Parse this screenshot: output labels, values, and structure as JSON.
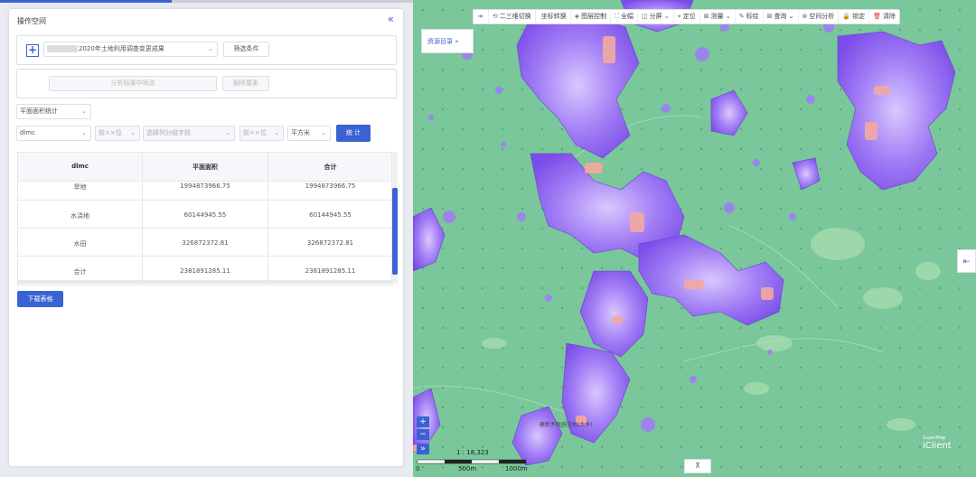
{
  "panel": {
    "title": "操作空间",
    "collapse_icon": "«",
    "layer_select": "2020年土地利用调查变更成果",
    "filter_button": "筛选条件",
    "analysis_filter_button": "分析结果中筛选",
    "delete_button": "删除要素",
    "stat_type": "平面面积统计",
    "field_select": "dlmc",
    "digits_select_1": "前××位",
    "group_field_placeholder": "选择列分组字段",
    "digits_select_2": "前××位",
    "unit_select": "平方米",
    "stat_button": "统 计",
    "download_button": "下载表格"
  },
  "table": {
    "headers": [
      "dlmc",
      "平面面积",
      "合计"
    ],
    "rows": [
      [
        "旱地",
        "1994873966.75",
        "1994873966.75"
      ],
      [
        "水浇地",
        "60144945.55",
        "60144945.55"
      ],
      [
        "水田",
        "326872372.81",
        "326872372.81"
      ],
      [
        "合计",
        "2381891285.11",
        "2381891285.11"
      ]
    ]
  },
  "map": {
    "toolbar": [
      {
        "icon": "collapse-right-icon",
        "glyph": "⇥",
        "label": ""
      },
      {
        "icon": "view-switch-icon",
        "glyph": "⟲",
        "label": "二三维切换"
      },
      {
        "icon": "coordinate-icon",
        "glyph": "",
        "label": "坐标转换"
      },
      {
        "icon": "layers-icon",
        "glyph": "◈",
        "label": "图层控制"
      },
      {
        "icon": "fullscreen-icon",
        "glyph": "⛶",
        "label": "全幅"
      },
      {
        "icon": "split-icon",
        "glyph": "◫",
        "label": "分屏 ⌄"
      },
      {
        "icon": "locate-icon",
        "glyph": "⌖",
        "label": "定位"
      },
      {
        "icon": "measure-icon",
        "glyph": "⊠",
        "label": "测量 ⌄"
      },
      {
        "icon": "draw-icon",
        "glyph": "✎",
        "label": "标绘"
      },
      {
        "icon": "query-icon",
        "glyph": "⊠",
        "label": "查询 ⌄"
      },
      {
        "icon": "spatial-analysis-icon",
        "glyph": "⊛",
        "label": "空间分析"
      },
      {
        "icon": "lock-icon",
        "glyph": "🔒",
        "label": "锁定"
      },
      {
        "icon": "trash-icon",
        "glyph": "🗑",
        "label": "清除"
      }
    ],
    "resource_catalog": "资源目录",
    "scale_label": "1 : 18,323",
    "scale_ticks": [
      "0",
      "500m",
      "1000m"
    ],
    "place_label": "建新乡政府驻地(大乡)",
    "logo_text": "iClient",
    "logo_sub": "SuperMap",
    "zoom_in": "+",
    "zoom_out": "−",
    "colors": {
      "base": "#79c79a",
      "dense": "#8a5cf0",
      "pink": "#f0a0a0",
      "accent": "#3a62d3"
    }
  }
}
